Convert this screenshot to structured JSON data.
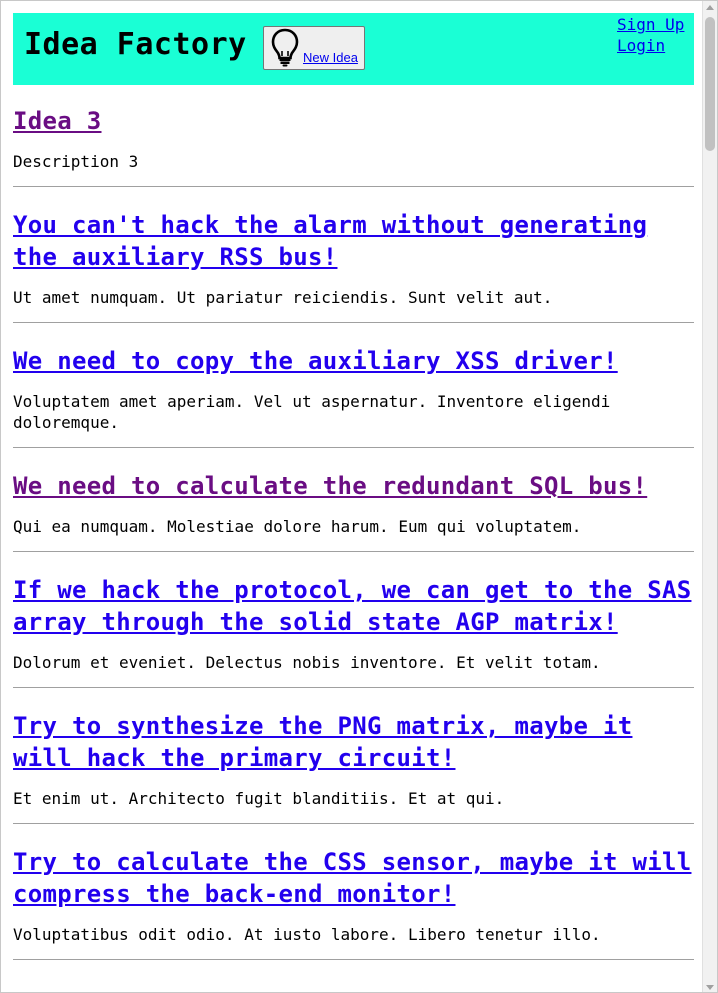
{
  "header": {
    "title": "Idea Factory",
    "new_idea_label": "New Idea",
    "new_idea_icon": "lightbulb-icon",
    "sign_up_label": "Sign Up",
    "login_label": "Login",
    "background_color": "#1affd5"
  },
  "ideas": [
    {
      "title": "Idea 3",
      "description": "Description 3",
      "visited": true
    },
    {
      "title": "You can't hack the alarm without generating the auxiliary RSS bus!",
      "description": "Ut amet numquam. Ut pariatur reiciendis. Sunt velit aut.",
      "visited": false
    },
    {
      "title": "We need to copy the auxiliary XSS driver!",
      "description": "Voluptatem amet aperiam. Vel ut aspernatur. Inventore eligendi doloremque.",
      "visited": false
    },
    {
      "title": "We need to calculate the redundant SQL bus!",
      "description": "Qui ea numquam. Molestiae dolore harum. Eum qui voluptatem.",
      "visited": true
    },
    {
      "title": "If we hack the protocol, we can get to the SAS array through the solid state AGP matrix!",
      "description": "Dolorum et eveniet. Delectus nobis inventore. Et velit totam.",
      "visited": false
    },
    {
      "title": "Try to synthesize the PNG matrix, maybe it will hack the primary circuit!",
      "description": "Et enim ut. Architecto fugit blanditiis. Et at qui.",
      "visited": false
    },
    {
      "title": "Try to calculate the CSS sensor, maybe it will compress the back-end monitor!",
      "description": "Voluptatibus odit odio. At iusto labore. Libero tenetur illo.",
      "visited": false
    }
  ],
  "colors": {
    "link": "#2200ee",
    "visited_link": "#6a0d83"
  }
}
